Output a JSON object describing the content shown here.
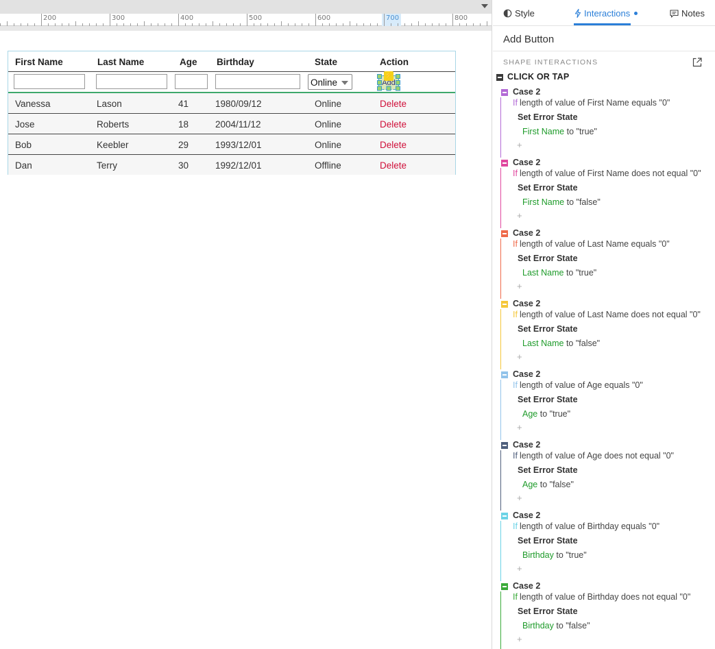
{
  "canvas": {
    "ruler_labels": [
      "200",
      "300",
      "400",
      "500",
      "600",
      "700",
      "800"
    ]
  },
  "table": {
    "headers": [
      "First Name",
      "Last Name",
      "Age",
      "Birthday",
      "State",
      "Action"
    ],
    "state_select_value": "Online",
    "add_button_label": "Add",
    "rows": [
      {
        "first": "Vanessa",
        "last": "Lason",
        "age": "41",
        "birthday": "1980/09/12",
        "state": "Online",
        "action": "Delete"
      },
      {
        "first": "Jose",
        "last": "Roberts",
        "age": "18",
        "birthday": "2004/11/12",
        "state": "Online",
        "action": "Delete"
      },
      {
        "first": "Bob",
        "last": "Keebler",
        "age": "29",
        "birthday": "1993/12/01",
        "state": "Online",
        "action": "Delete"
      },
      {
        "first": "Dan",
        "last": "Terry",
        "age": "30",
        "birthday": "1992/12/01",
        "state": "Offline",
        "action": "Delete"
      }
    ]
  },
  "panel": {
    "tabs": {
      "style": "Style",
      "interactions": "Interactions",
      "notes": "Notes"
    },
    "title": "Add Button",
    "section_label": "SHAPE INTERACTIONS",
    "event_label": "CLICK OR TAP",
    "cases": [
      {
        "name": "Case 2",
        "if": "If",
        "condition": "length of value of First Name equals \"0\"",
        "action": "Set Error State",
        "target": "First Name",
        "value": "to \"true\"",
        "add": "+",
        "color": "#b36ad6"
      },
      {
        "name": "Case 2",
        "if": "If",
        "condition": "length of value of First Name does not equal \"0\"",
        "action": "Set Error State",
        "target": "First Name",
        "value": "to \"false\"",
        "add": "+",
        "color": "#e0479e"
      },
      {
        "name": "Case 2",
        "if": "If",
        "condition": "length of value of Last Name equals \"0\"",
        "action": "Set Error State",
        "target": "Last Name",
        "value": "to \"true\"",
        "add": "+",
        "color": "#ef6a4a"
      },
      {
        "name": "Case 2",
        "if": "If",
        "condition": "length of value of Last Name does not equal \"0\"",
        "action": "Set Error State",
        "target": "Last Name",
        "value": "to \"false\"",
        "add": "+",
        "color": "#f5c73a"
      },
      {
        "name": "Case 2",
        "if": "If",
        "condition": "length of value of Age equals \"0\"",
        "action": "Set Error State",
        "target": "Age",
        "value": "to \"true\"",
        "add": "+",
        "color": "#92c3ea"
      },
      {
        "name": "Case 2",
        "if": "If",
        "condition": "length of value of Age does not equal \"0\"",
        "action": "Set Error State",
        "target": "Age",
        "value": "to \"false\"",
        "add": "+",
        "color": "#4f5f7c"
      },
      {
        "name": "Case 2",
        "if": "If",
        "condition": "length of value of Birthday equals \"0\"",
        "action": "Set Error State",
        "target": "Birthday",
        "value": "to \"true\"",
        "add": "+",
        "color": "#6bd3e6"
      },
      {
        "name": "Case 2",
        "if": "If",
        "condition": "length of value of Birthday does not equal \"0\"",
        "action": "Set Error State",
        "target": "Birthday",
        "value": "to \"false\"",
        "add": "+",
        "color": "#3aaa3a"
      }
    ]
  },
  "colors": {
    "accent": "#2b7fd8",
    "delete": "#d0103a",
    "target_green": "#1e9b2a"
  }
}
